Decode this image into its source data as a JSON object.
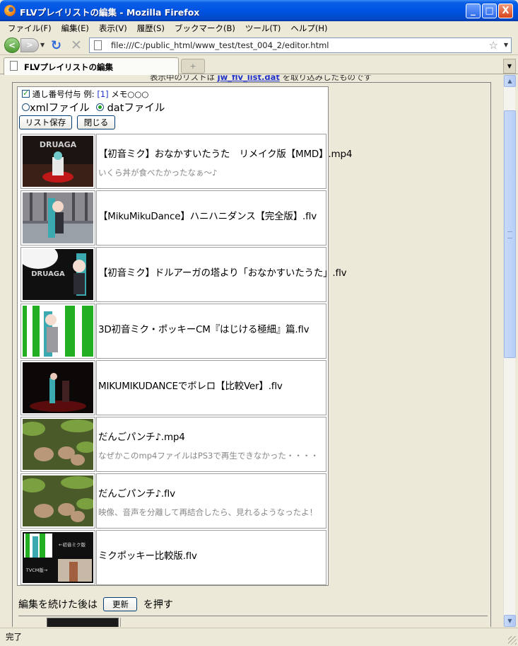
{
  "window": {
    "title": "FLVプレイリストの編集 - Mozilla Firefox",
    "minimize_glyph": "_",
    "maximize_glyph": "□",
    "close_glyph": "X"
  },
  "menubar": [
    "ファイル(F)",
    "編集(E)",
    "表示(V)",
    "履歴(S)",
    "ブックマーク(B)",
    "ツール(T)",
    "ヘルプ(H)"
  ],
  "navbar": {
    "back_glyph": "<",
    "forward_glyph": ">",
    "dropdown_glyph": "▼",
    "reload_glyph": "↻",
    "stop_glyph": "✕",
    "url": "file:///C:/public_html/www_test/test_004_2/editor.html",
    "star_glyph": "☆"
  },
  "tabs": {
    "active_label": "FLVプレイリストの編集",
    "new_tab_glyph": "+",
    "list_glyph": "▼"
  },
  "page": {
    "top_note_prefix": "表示中のリストは",
    "top_note_link": "jw_flv_list.dat",
    "top_note_suffix": "を取り込みしたものです",
    "serial_label": "通し番号付与 例:",
    "serial_example": "[1]",
    "serial_suffix": "メモ○○○",
    "xml_label": "xmlファイル",
    "dat_label": "datファイル",
    "save_button": "リスト保存",
    "close_button": "閉じる",
    "after_edit_prefix": "編集を続けた後は",
    "refresh_button": "更新",
    "after_edit_suffix": "を押す"
  },
  "playlist": [
    {
      "title": "【初音ミク】おなかすいたうた　リメイク版【MMD】.mp4",
      "memo": "いくら丼が食べたかったなぁ～♪",
      "thumb_caption": "DRUAGA"
    },
    {
      "title": "【MikuMikuDance】ハニハニダンス【完全版】.flv",
      "memo": "",
      "thumb_caption": ""
    },
    {
      "title": "【初音ミク】ドルアーガの塔より「おなかすいたうた」.flv",
      "memo": "",
      "thumb_caption": "DRUAGA"
    },
    {
      "title": "3D初音ミク・ポッキーCM『はじける極細』篇.flv",
      "memo": "",
      "thumb_caption": ""
    },
    {
      "title": "MIKUMIKUDANCEでボレロ【比較Ver】.flv",
      "memo": "",
      "thumb_caption": ""
    },
    {
      "title": "だんごパンチ♪.mp4",
      "memo": "なぜかこのmp4ファイルはPS3で再生できなかった・・・・",
      "thumb_caption": ""
    },
    {
      "title": "だんごパンチ♪.flv",
      "memo": "映像、音声を分離して再結合したら、見れるようなったよ！",
      "thumb_caption": ""
    },
    {
      "title": "ミクポッキー比較版.flv",
      "memo": "",
      "thumb_caption": "←初音ミク版",
      "thumb_caption2": "TVCM版→"
    }
  ],
  "status": {
    "text": "完了"
  },
  "scrollbar": {
    "up_glyph": "▲",
    "down_glyph": "▼",
    "position_fraction": 0.06
  }
}
